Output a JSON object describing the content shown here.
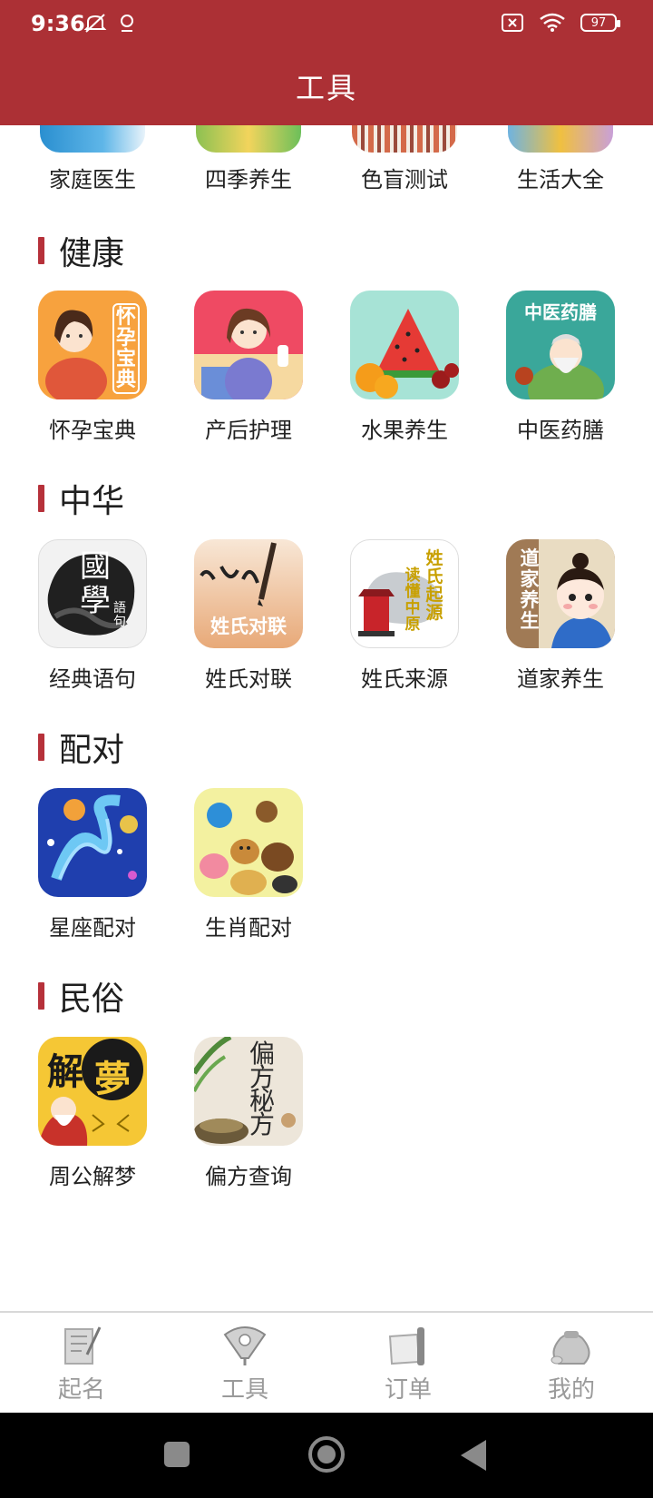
{
  "status": {
    "time": "9:36",
    "battery": "97",
    "icons_left": [
      "mute-icon",
      "location-icon"
    ],
    "icons_right": [
      "no-sim-icon",
      "wifi-icon",
      "battery-icon"
    ]
  },
  "appbar": {
    "title": "工具"
  },
  "partial_row": [
    {
      "label": "家庭医生",
      "icon": "family-doctor-icon"
    },
    {
      "label": "四季养生",
      "icon": "seasons-icon"
    },
    {
      "label": "色盲测试",
      "icon": "color-blind-icon"
    },
    {
      "label": "生活大全",
      "icon": "life-icon"
    }
  ],
  "sections": [
    {
      "title": "健康",
      "items": [
        {
          "label": "怀孕宝典",
          "icon_text": "怀孕宝典",
          "icon": "pregnancy-icon"
        },
        {
          "label": "产后护理",
          "icon": "postpartum-icon"
        },
        {
          "label": "水果养生",
          "icon": "fruit-icon"
        },
        {
          "label": "中医药膳",
          "icon_text": "中医药膳",
          "icon": "tcm-icon"
        }
      ]
    },
    {
      "title": "中华",
      "items": [
        {
          "label": "经典语句",
          "icon_text": "國學",
          "icon_text2": "語句",
          "icon": "classic-quotes-icon"
        },
        {
          "label": "姓氏对联",
          "icon_text": "姓氏对联",
          "icon": "couplet-icon"
        },
        {
          "label": "姓氏来源",
          "icon_text": "姓氏起源",
          "icon_text2": "读懂中原",
          "icon": "surname-origin-icon"
        },
        {
          "label": "道家养生",
          "icon_text": "道家养生",
          "icon": "taoist-icon"
        }
      ]
    },
    {
      "title": "配对",
      "items": [
        {
          "label": "星座配对",
          "icon": "constellation-icon"
        },
        {
          "label": "生肖配对",
          "icon": "zodiac-icon"
        }
      ]
    },
    {
      "title": "民俗",
      "items": [
        {
          "label": "周公解梦",
          "icon_text": "解",
          "icon_text2": "夢",
          "icon": "dream-icon"
        },
        {
          "label": "偏方查询",
          "icon_text": "偏方秘方",
          "icon": "remedy-icon"
        }
      ]
    }
  ],
  "bottom_nav": [
    {
      "label": "起名",
      "icon": "naming-icon"
    },
    {
      "label": "工具",
      "icon": "fan-icon"
    },
    {
      "label": "订单",
      "icon": "scroll-icon"
    },
    {
      "label": "我的",
      "icon": "money-bag-icon"
    }
  ],
  "colors": {
    "brand": "#ac3035",
    "accent_bar": "#b6313a",
    "nav_inactive": "#9a9a9a"
  }
}
